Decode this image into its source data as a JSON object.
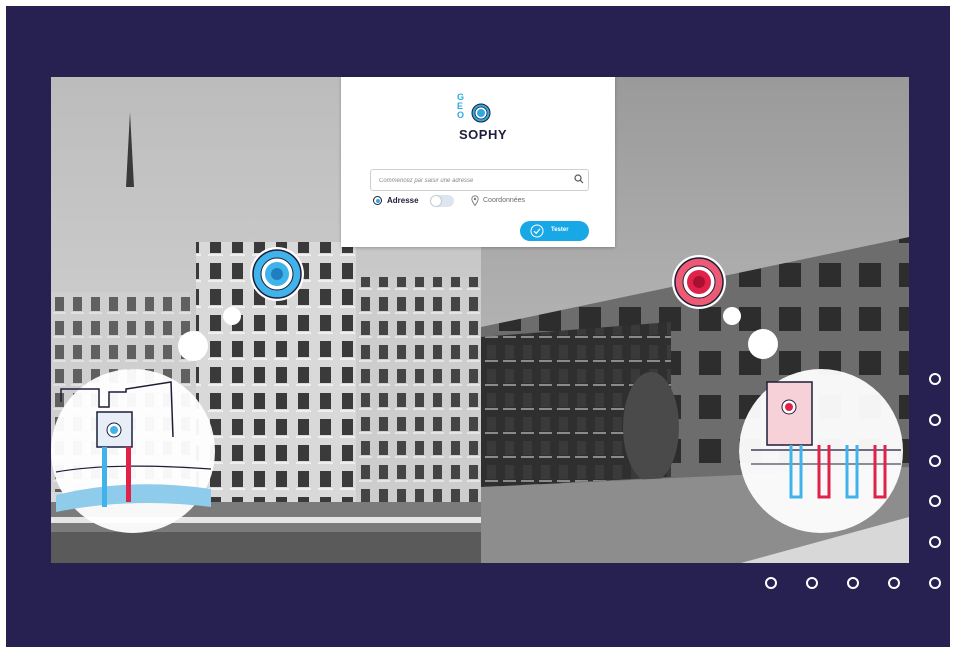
{
  "logo": {
    "letters": [
      "G",
      "E",
      "O"
    ],
    "wordmark": "SOPHY"
  },
  "search": {
    "placeholder": "Commencez par saisir une adresse",
    "value": ""
  },
  "modes": {
    "address_label": "Adresse",
    "coordinates_label": "Coordonnées",
    "toggle_on": false
  },
  "submit": {
    "label": "Tester"
  },
  "colors": {
    "background": "#262150",
    "accent_blue": "#19a8e6",
    "accent_red": "#e0224a"
  },
  "icons": [
    "search-icon",
    "location-pin-icon",
    "check-circle-icon",
    "radio-icon"
  ],
  "decoration": {
    "dot_count": 10
  }
}
